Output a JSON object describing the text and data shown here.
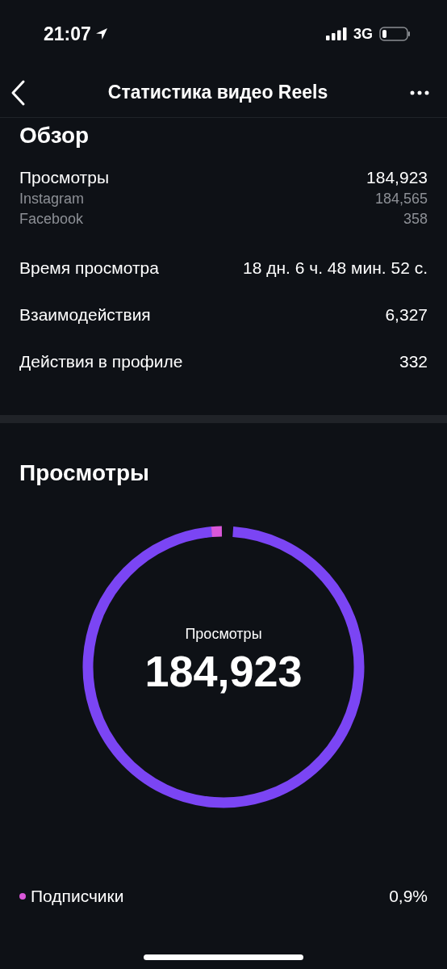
{
  "status_bar": {
    "time": "21:07",
    "network": "3G"
  },
  "header": {
    "title": "Статистика видео Reels"
  },
  "overview": {
    "title": "Обзор",
    "rows": [
      {
        "kind": "split",
        "label": "Просмотры",
        "value": "184,923",
        "sub": [
          {
            "label": "Instagram",
            "value": "184,565"
          },
          {
            "label": "Facebook",
            "value": "358"
          }
        ]
      },
      {
        "kind": "plain",
        "label": "Время просмотра",
        "value": "18 дн. 6 ч. 48 мин. 52 с."
      },
      {
        "kind": "plain",
        "label": "Взаимодействия",
        "value": "6,327"
      },
      {
        "kind": "plain",
        "label": "Действия в профиле",
        "value": "332"
      }
    ]
  },
  "views": {
    "title": "Просмотры",
    "center_label": "Просмотры",
    "center_value": "184,923",
    "legend": [
      {
        "label": "Подписчики",
        "value": "0,9%",
        "color": "#d957d9"
      }
    ]
  }
}
